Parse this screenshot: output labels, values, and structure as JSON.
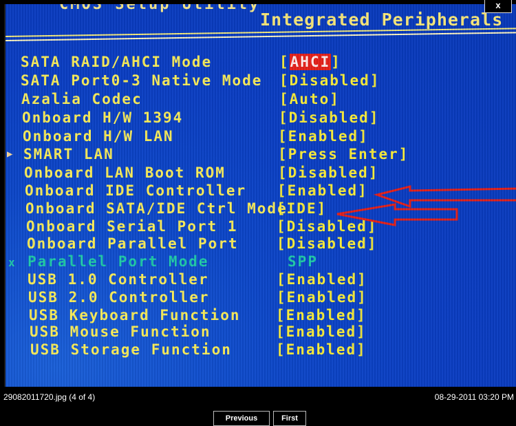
{
  "viewer": {
    "close_label": "x",
    "filename": "29082011720.jpg (4 of 4)",
    "timestamp": "08-29-2011 03:20 PM",
    "buttons": {
      "previous": "Previous",
      "first": "First"
    }
  },
  "bios": {
    "header_partial": "CMOS Setup Utility",
    "section_title": "Integrated Peripherals",
    "colors": {
      "background": "#0a3dc2",
      "text": "#f8ec5a",
      "disabled_text": "#1fc9a8",
      "highlight": "#e4201a",
      "annotation": "#e4201a"
    },
    "items": [
      {
        "label": "SATA RAID/AHCI Mode",
        "value": "AHCI",
        "bracketed": true,
        "selected": true,
        "marker": ""
      },
      {
        "label": "SATA Port0-3 Native Mode",
        "value": "Disabled",
        "bracketed": true,
        "marker": ""
      },
      {
        "label": "Azalia Codec",
        "value": "Auto",
        "bracketed": true,
        "marker": ""
      },
      {
        "label": "Onboard H/W 1394",
        "value": "Disabled",
        "bracketed": true,
        "marker": ""
      },
      {
        "label": "Onboard H/W LAN",
        "value": "Enabled",
        "bracketed": true,
        "marker": ""
      },
      {
        "label": "SMART LAN",
        "value": "Press Enter",
        "bracketed": true,
        "marker": "▶"
      },
      {
        "label": "Onboard LAN Boot ROM",
        "value": "Disabled",
        "bracketed": true,
        "marker": ""
      },
      {
        "label": "Onboard IDE Controller",
        "value": "Enabled",
        "bracketed": true,
        "marker": "",
        "annotated": true
      },
      {
        "label": "Onboard SATA/IDE Ctrl Mode",
        "value": "IDE",
        "bracketed": true,
        "marker": "",
        "annotated": true
      },
      {
        "label": "Onboard Serial Port 1",
        "value": "Disabled",
        "bracketed": true,
        "marker": ""
      },
      {
        "label": "Onboard Parallel Port",
        "value": "Disabled",
        "bracketed": true,
        "marker": ""
      },
      {
        "label": "Parallel Port Mode",
        "value": "SPP",
        "bracketed": false,
        "marker": "x",
        "disabled": true
      },
      {
        "label": "USB 1.0 Controller",
        "value": "Enabled",
        "bracketed": true,
        "marker": ""
      },
      {
        "label": "USB 2.0 Controller",
        "value": "Enabled",
        "bracketed": true,
        "marker": ""
      },
      {
        "label": "USB Keyboard Function",
        "value": "Enabled",
        "bracketed": true,
        "marker": ""
      },
      {
        "label": "USB Mouse Function",
        "value": "Enabled",
        "bracketed": true,
        "marker": ""
      },
      {
        "label": "USB Storage Function",
        "value": "Enabled",
        "bracketed": true,
        "marker": ""
      }
    ]
  }
}
